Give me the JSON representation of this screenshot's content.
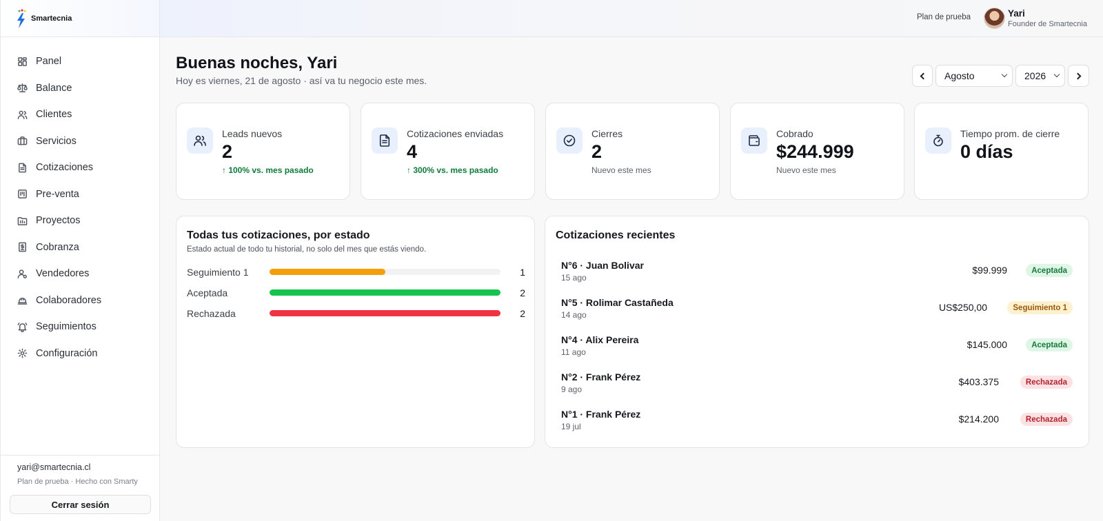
{
  "brand": {
    "name": "Smartecnia"
  },
  "sidebar": {
    "items": [
      {
        "label": "Panel",
        "icon": "dashboard-icon"
      },
      {
        "label": "Balance",
        "icon": "scale-icon"
      },
      {
        "label": "Clientes",
        "icon": "users-icon"
      },
      {
        "label": "Servicios",
        "icon": "briefcase-icon"
      },
      {
        "label": "Cotizaciones",
        "icon": "document-icon"
      },
      {
        "label": "Pre-venta",
        "icon": "kanban-icon"
      },
      {
        "label": "Proyectos",
        "icon": "folder-icon"
      },
      {
        "label": "Cobranza",
        "icon": "receipt-icon"
      },
      {
        "label": "Vendedores",
        "icon": "user-settings-icon"
      },
      {
        "label": "Colaboradores",
        "icon": "hard-hat-icon"
      },
      {
        "label": "Seguimientos",
        "icon": "bell-icon"
      },
      {
        "label": "Configuración",
        "icon": "gear-icon"
      }
    ],
    "footer": {
      "email": "yari@smartecnia.cl",
      "plan": "Plan de prueba · Hecho con Smarty",
      "logout_label": "Cerrar sesión"
    }
  },
  "topbar": {
    "plan_link": "Plan de prueba",
    "user_name": "Yari",
    "user_role": "Founder de Smartecnia"
  },
  "header": {
    "greeting": "Buenas noches, Yari",
    "subtitle": "Hoy es viernes, 21 de agosto · así va tu negocio este mes.",
    "month": "Agosto",
    "year": "2026"
  },
  "kpis": [
    {
      "label": "Leads nuevos",
      "value": "2",
      "note": "↑ 100% vs. mes pasado",
      "icon": "users-icon"
    },
    {
      "label": "Cotizaciones enviadas",
      "value": "4",
      "note": "↑ 300% vs. mes pasado",
      "icon": "document-icon"
    },
    {
      "label": "Cierres",
      "value": "2",
      "note": "Nuevo este mes",
      "icon": "check-circle-icon"
    },
    {
      "label": "Cobrado",
      "value": "$244.999",
      "note": "Nuevo este mes",
      "icon": "wallet-icon"
    },
    {
      "label": "Tiempo prom. de cierre",
      "value": "0 días",
      "note": "",
      "icon": "stopwatch-icon"
    }
  ],
  "status_panel": {
    "title": "Todas tus cotizaciones, por estado",
    "subtitle": "Estado actual de todo tu historial, no solo del mes que estás viendo.",
    "rows": [
      {
        "label": "Seguimiento 1",
        "count": "1",
        "fraction": 0.5,
        "color": "#f59e0b"
      },
      {
        "label": "Aceptada",
        "count": "2",
        "fraction": 1.0,
        "color": "#16c44d"
      },
      {
        "label": "Rechazada",
        "count": "2",
        "fraction": 1.0,
        "color": "#ef3340"
      }
    ]
  },
  "recent_panel": {
    "title": "Cotizaciones recientes",
    "items": [
      {
        "title": "N°6 · Juan Bolivar",
        "date": "15 ago",
        "amount": "$99.999",
        "status": "Aceptada",
        "kind": "ok"
      },
      {
        "title": "N°5 · Rolimar Castañeda",
        "date": "14 ago",
        "amount": "US$250,00",
        "status": "Seguimiento 1",
        "kind": "warn"
      },
      {
        "title": "N°4 · Alix Pereira",
        "date": "11 ago",
        "amount": "$145.000",
        "status": "Aceptada",
        "kind": "ok"
      },
      {
        "title": "N°2 · Frank Pérez",
        "date": "9 ago",
        "amount": "$403.375",
        "status": "Rechazada",
        "kind": "bad"
      },
      {
        "title": "N°1 · Frank Pérez",
        "date": "19 jul",
        "amount": "$214.200",
        "status": "Rechazada",
        "kind": "bad"
      }
    ]
  }
}
